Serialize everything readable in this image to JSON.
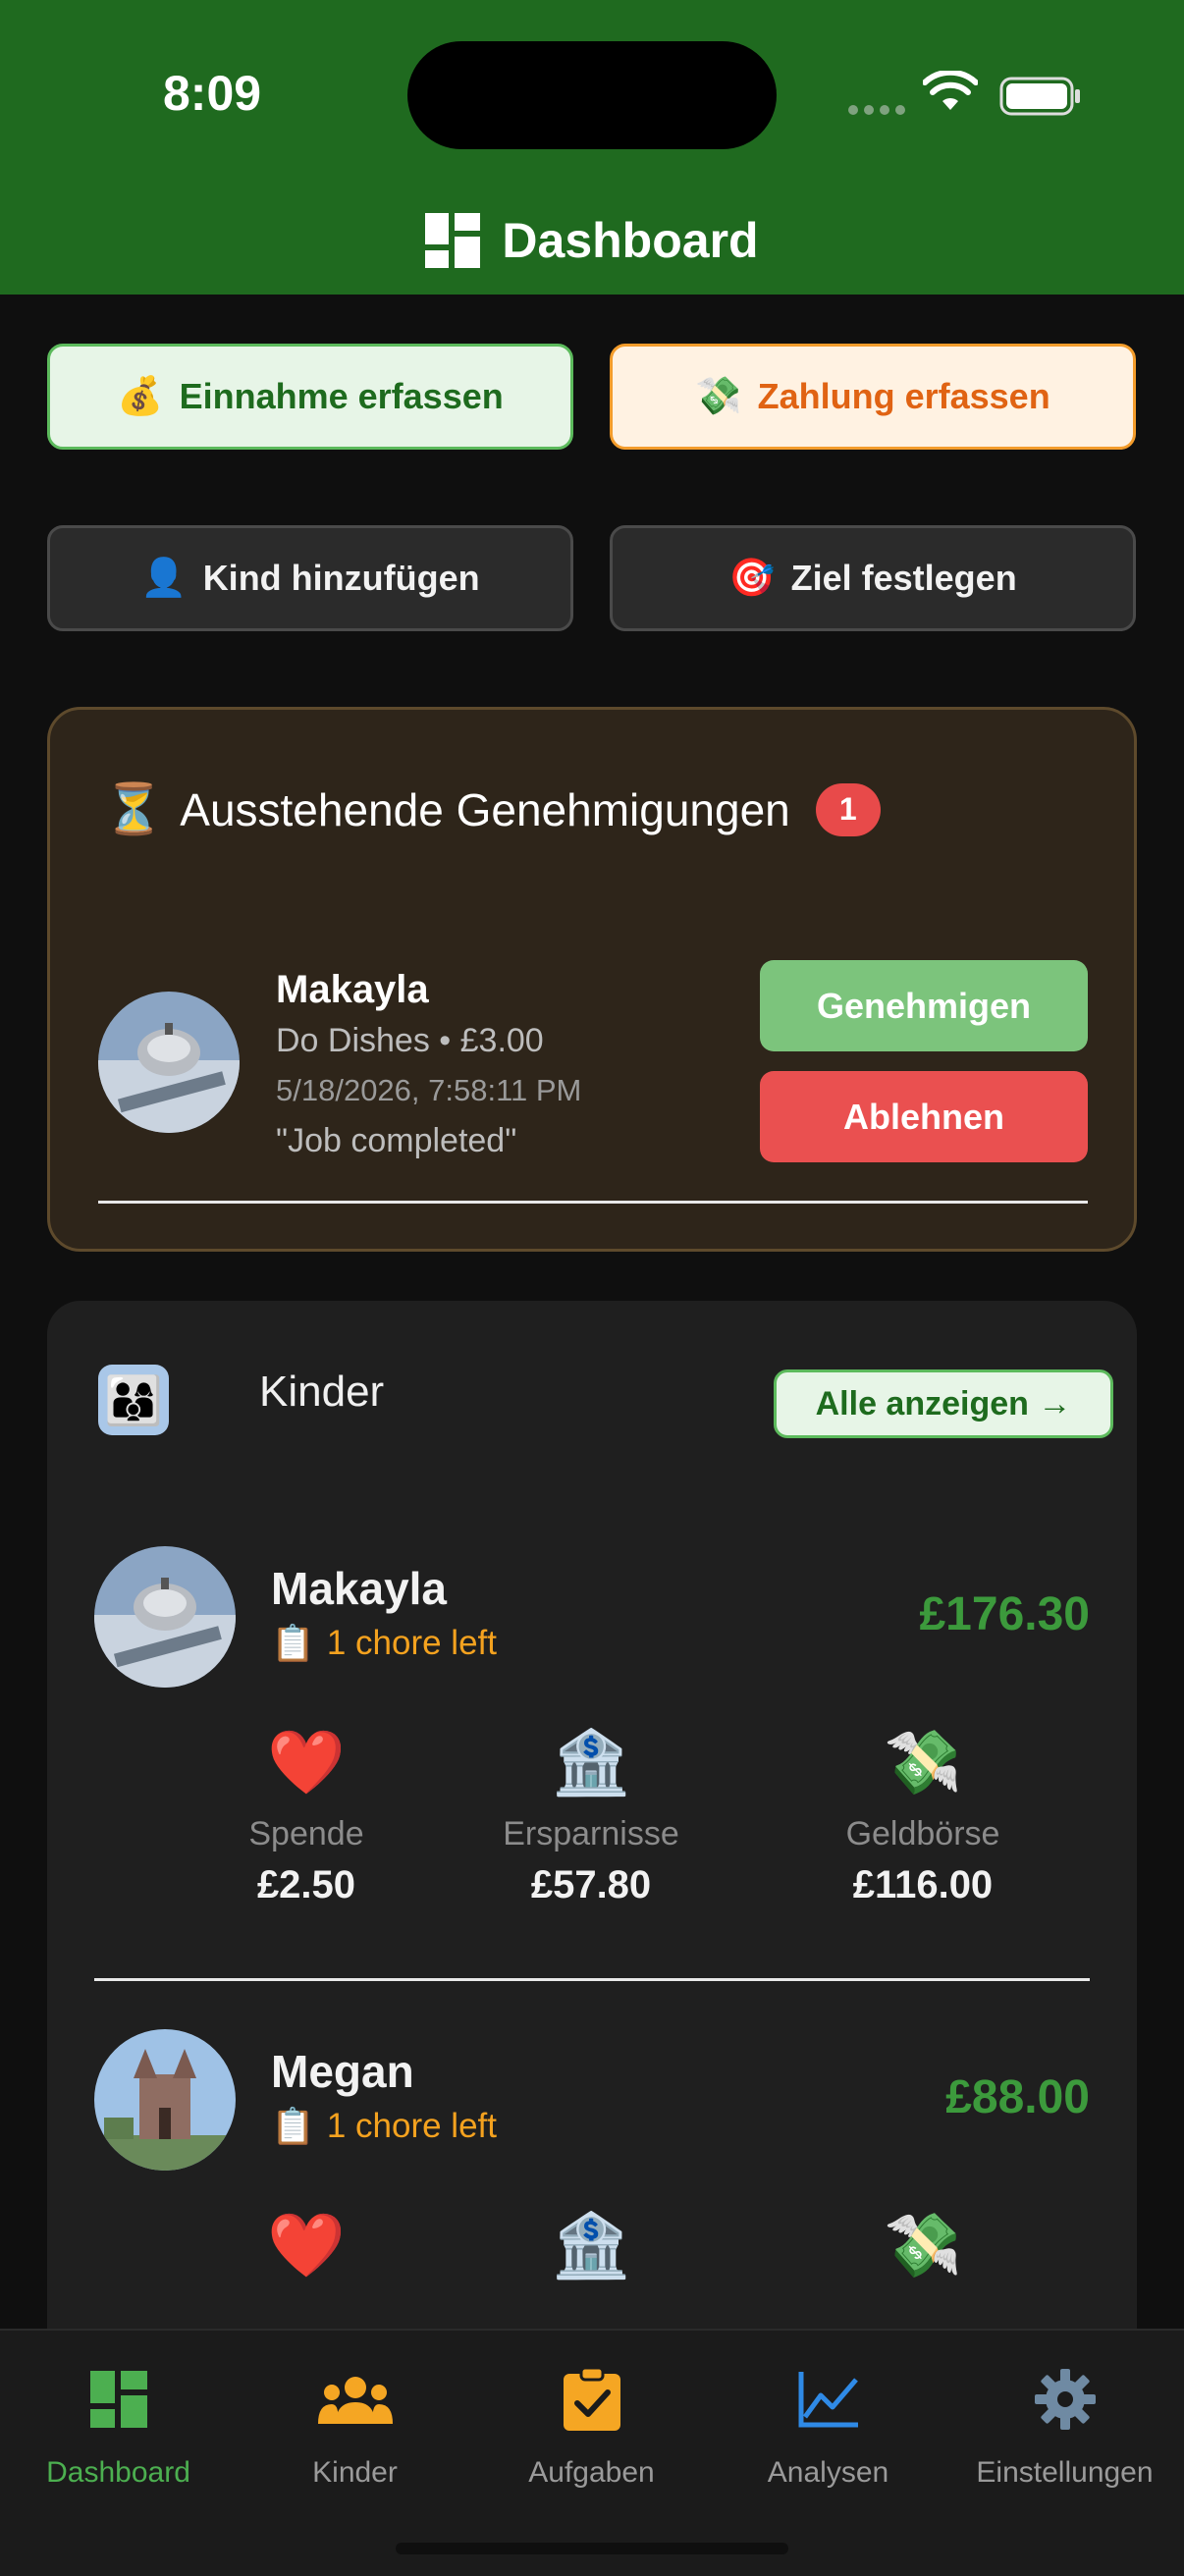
{
  "status_bar": {
    "time": "8:09"
  },
  "header": {
    "title": "Dashboard"
  },
  "actions": [
    {
      "emoji": "💰",
      "label": "Einnahme erfassen"
    },
    {
      "emoji": "💸",
      "label": "Zahlung erfassen"
    },
    {
      "emoji": "👤",
      "label": "Kind hinzufügen"
    },
    {
      "emoji": "🎯",
      "label": "Ziel festlegen"
    }
  ],
  "pending": {
    "emoji": "⏳",
    "title": "Ausstehende Genehmigungen",
    "count": "1",
    "item": {
      "name": "Makayla",
      "task_amount": "Do Dishes • £3.00",
      "datetime": "5/18/2026, 7:58:11 PM",
      "note": "\"Job completed\"",
      "approve_label": "Genehmigen",
      "reject_label": "Ablehnen"
    }
  },
  "kids": {
    "emoji": "👨‍👩‍👦",
    "title": "Kinder",
    "all_label": "Alle anzeigen →",
    "children": [
      {
        "name": "Makayla",
        "chores": "1 chore left",
        "chores_emoji": "📋",
        "balance": "£176.30",
        "buckets": [
          {
            "emoji": "❤️",
            "label": "Spende",
            "value": "£2.50"
          },
          {
            "emoji": "🏦",
            "label": "Ersparnisse",
            "value": "£57.80"
          },
          {
            "emoji": "💸",
            "label": "Geldbörse",
            "value": "£116.00"
          }
        ]
      },
      {
        "name": "Megan",
        "chores": "1 chore left",
        "chores_emoji": "📋",
        "balance": "£88.00",
        "buckets": [
          {
            "emoji": "❤️"
          },
          {
            "emoji": "🏦"
          },
          {
            "emoji": "💸"
          }
        ]
      }
    ]
  },
  "tabbar": {
    "active_color": "#4caf50",
    "tabs": [
      {
        "label": "Dashboard",
        "icon": "dashboard-icon",
        "color": "#4caf50"
      },
      {
        "label": "Kinder",
        "icon": "group-icon",
        "color": "#f5a623"
      },
      {
        "label": "Aufgaben",
        "icon": "clipboard-check-icon",
        "color": "#f5a623"
      },
      {
        "label": "Analysen",
        "icon": "chart-line-icon",
        "color": "#2f8ae6"
      },
      {
        "label": "Einstellungen",
        "icon": "gear-icon",
        "color": "#6f8aa3"
      }
    ]
  }
}
